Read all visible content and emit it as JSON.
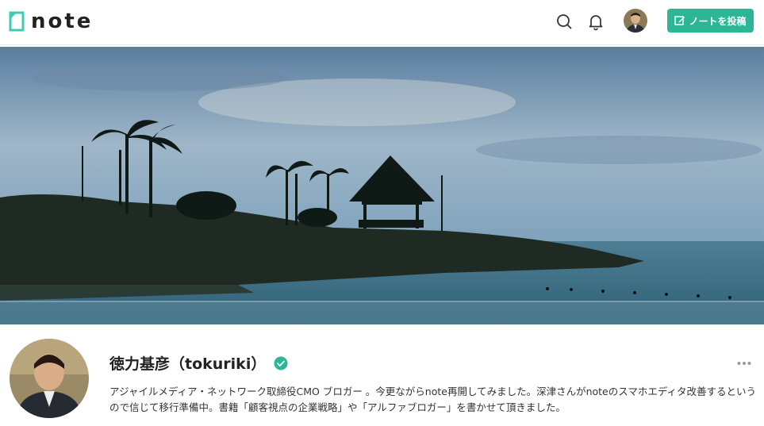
{
  "header": {
    "logo_text": "note",
    "post_button_label": "ノートを投稿"
  },
  "profile": {
    "name": "徳力基彦（tokuriki）",
    "bio": "アジャイルメディア・ネットワーク取締役CMO ブロガー 。今更ながらnote再開してみました。深津さんがnoteのスマホエディタ改善するというので信じて移行準備中。書籍「顧客視点の企業戦略」や「アルファブロガー」を書かせて頂きました。"
  },
  "icons": [
    "note-logo-icon",
    "search-icon",
    "bell-icon",
    "pencil-icon",
    "verified-icon",
    "more-icon"
  ],
  "colors": {
    "accent": "#2cb696",
    "text": "#222222"
  }
}
